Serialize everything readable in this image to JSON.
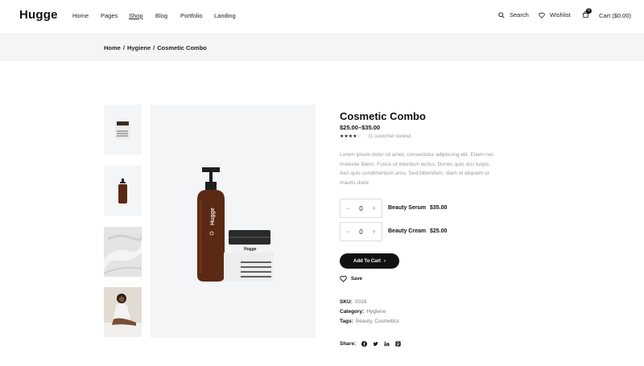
{
  "header": {
    "logo": "Hugge",
    "nav": [
      "Home",
      "Pages",
      "Shop",
      "Blog",
      "Portfolio",
      "Landing"
    ],
    "active_nav": "Shop",
    "search_label": "Search",
    "wishlist_label": "Wishlist",
    "cart_label": "Cart ($0.00)",
    "cart_count": "0"
  },
  "breadcrumb": {
    "items": [
      "Home",
      "/",
      "Hygiene",
      "/",
      "Cosmetic Combo"
    ]
  },
  "product": {
    "title": "Cosmetic Combo",
    "price": "$25.00–$35.00",
    "rating": 4,
    "rating_max": 5,
    "review_text": "(1 customer review)",
    "description": "Lorem ipsum dolor sit amet, consectetur adipiscing elit. Etiam nec molestie libero. Fusce ut interdum lectus. Donec quis orci turpis. Aen quis condimentum arcu. Sed bibendum, diam et aliquam ut mauris dolor.",
    "items": [
      {
        "name": "Beauty Serum",
        "price": "$35.00",
        "qty": "0",
        "minus": "−",
        "plus": "+"
      },
      {
        "name": "Beauty Cream",
        "price": "$25.00",
        "qty": "0",
        "minus": "−",
        "plus": "+"
      }
    ],
    "add_to_cart": "Add To Cart",
    "save_label": "Save",
    "sku_label": "SKU:",
    "sku": "0016",
    "category_label": "Category:",
    "category": "Hygiene",
    "tags_label": "Tags:",
    "tags": "Beauty, Cosmetics",
    "share_label": "Share:",
    "bottle_brand": "Hugge",
    "jar_brand": "Hugge"
  },
  "icons": {
    "search": "search-icon",
    "wishlist": "heart-icon",
    "cart": "cart-icon",
    "share": [
      "facebook-icon",
      "twitter-icon",
      "linkedin-icon",
      "pinterest-icon"
    ]
  },
  "colors": {
    "accent": "#111111",
    "breadcrumb_bg": "#f5f5f5",
    "image_bg": "#f3f5f7",
    "bottle": "#5a2a14"
  }
}
